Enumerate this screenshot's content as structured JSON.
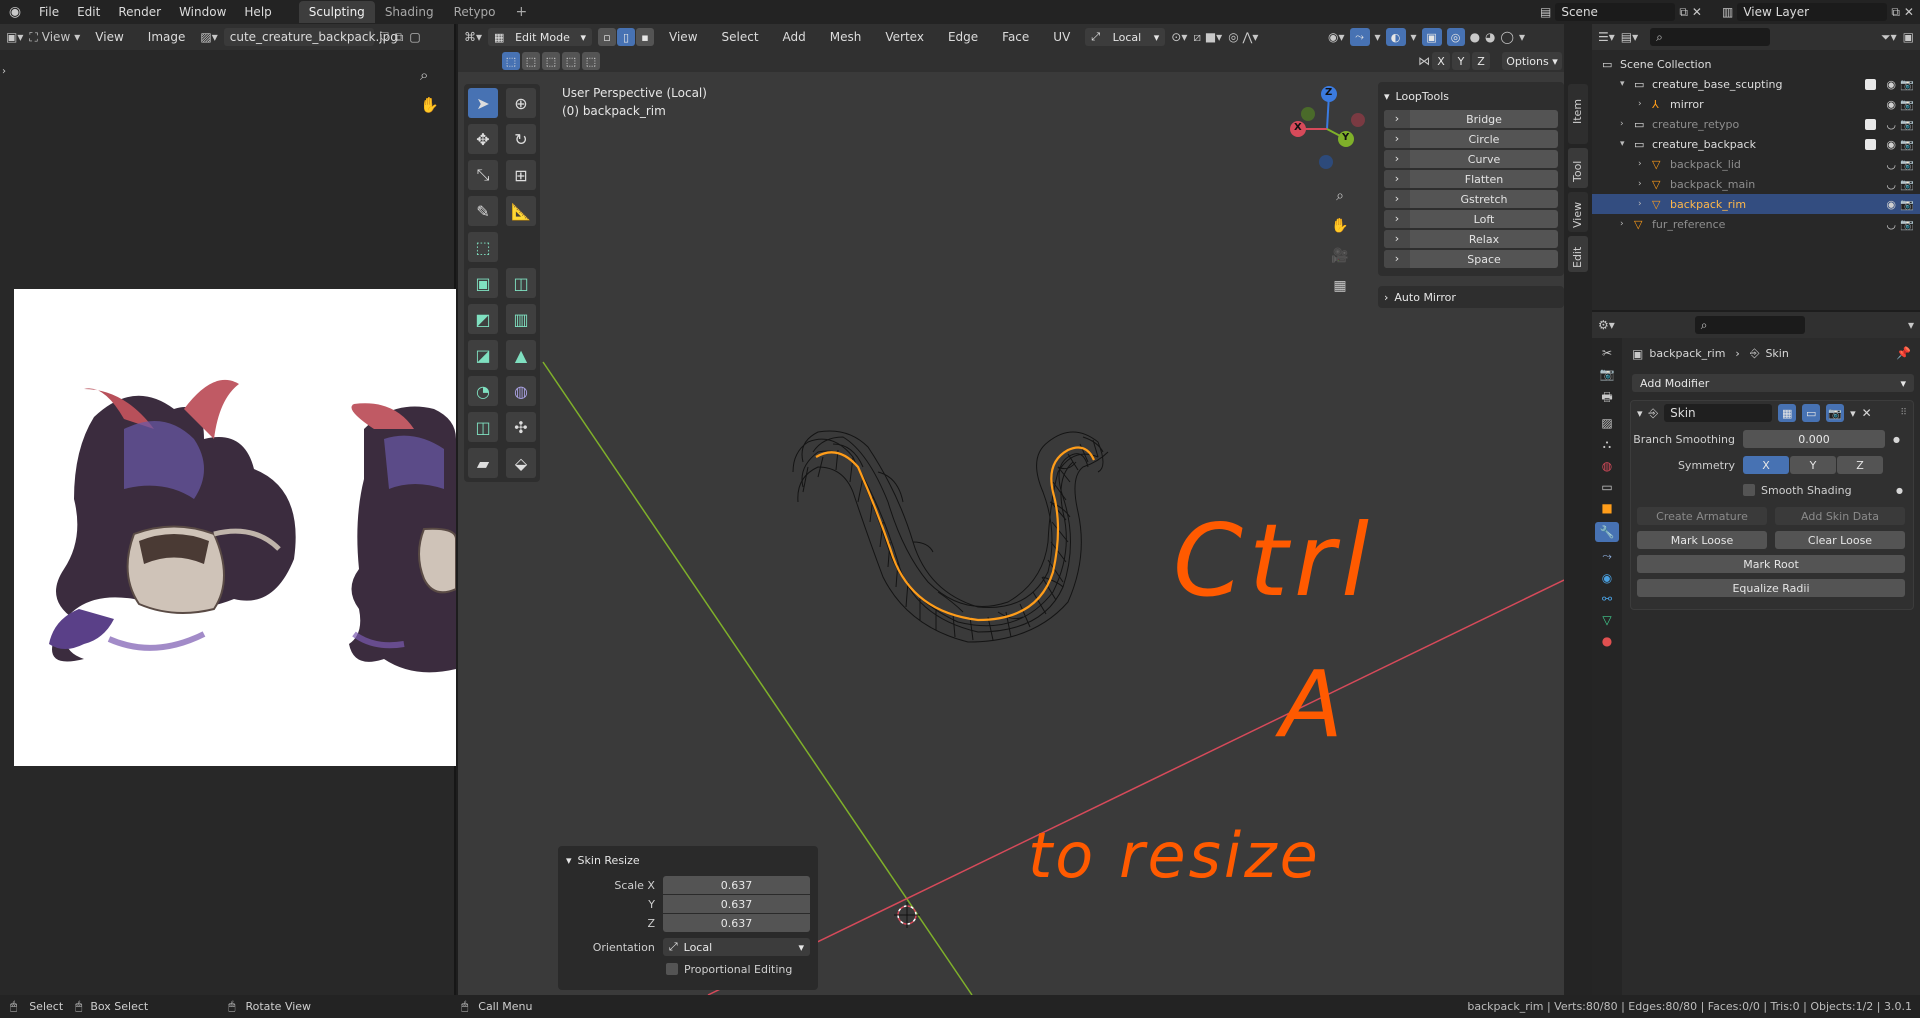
{
  "topbar": {
    "menus": [
      "File",
      "Edit",
      "Render",
      "Window",
      "Help"
    ],
    "workspaces": [
      {
        "label": "Sculpting",
        "active": true
      },
      {
        "label": "Shading",
        "active": false
      },
      {
        "label": "Retypo",
        "active": false
      }
    ],
    "add_workspace": "+",
    "scene": "Scene",
    "view_layer": "View Layer"
  },
  "image_editor": {
    "view_menu": "View",
    "menus": [
      "View",
      "Image"
    ],
    "image_name": "cute_creature_backpack.jpg"
  },
  "viewport_header": {
    "mode": "Edit Mode",
    "menus": [
      "View",
      "Select",
      "Add",
      "Mesh",
      "Vertex",
      "Edge",
      "Face",
      "UV"
    ],
    "transform_orientation": "Local",
    "axes": [
      "X",
      "Y",
      "Z"
    ],
    "options": "Options"
  },
  "viewport": {
    "perspective_label": "User Perspective (Local)",
    "object_label": "(0) backpack_rim",
    "gizmo": {
      "x": "X",
      "y": "Y",
      "z": "Z"
    },
    "annotations": [
      "Ctrl",
      "A",
      "to resize"
    ]
  },
  "loop_tools": {
    "title": "LoopTools",
    "items": [
      "Bridge",
      "Circle",
      "Curve",
      "Flatten",
      "Gstretch",
      "Loft",
      "Relax",
      "Space"
    ],
    "auto_mirror": "Auto Mirror"
  },
  "npanel_tabs": [
    "Item",
    "Tool",
    "View",
    "Edit"
  ],
  "skin_resize": {
    "title": "Skin Resize",
    "scale_label": "Scale X",
    "y_label": "Y",
    "z_label": "Z",
    "x": "0.637",
    "y": "0.637",
    "z": "0.637",
    "orientation_label": "Orientation",
    "orientation": "Local",
    "proportional": "Proportional Editing"
  },
  "outliner": {
    "rows": [
      {
        "label": "Scene Collection",
        "indent": 0,
        "type": "collection"
      },
      {
        "label": "creature_base_scupting",
        "indent": 1,
        "type": "collection",
        "check": true
      },
      {
        "label": "mirror",
        "indent": 2,
        "type": "armature"
      },
      {
        "label": "creature_retypo",
        "indent": 1,
        "type": "collection",
        "dim": true,
        "check": true
      },
      {
        "label": "creature_backpack",
        "indent": 1,
        "type": "collection",
        "check": true
      },
      {
        "label": "backpack_lid",
        "indent": 2,
        "type": "mesh",
        "dim": true
      },
      {
        "label": "backpack_main",
        "indent": 2,
        "type": "mesh",
        "dim": true
      },
      {
        "label": "backpack_rim",
        "indent": 2,
        "type": "mesh",
        "selected": true
      },
      {
        "label": "fur_reference",
        "indent": 1,
        "type": "mesh",
        "dim": true
      }
    ]
  },
  "properties": {
    "breadcrumb_object": "backpack_rim",
    "breadcrumb_modifier": "Skin",
    "add_modifier": "Add Modifier",
    "modifier_name": "Skin",
    "branch_smoothing_label": "Branch Smoothing",
    "branch_smoothing": "0.000",
    "symmetry_label": "Symmetry",
    "symmetry": [
      "X",
      "Y",
      "Z"
    ],
    "smooth_shading": "Smooth Shading",
    "create_armature": "Create Armature",
    "add_skin_data": "Add Skin Data",
    "mark_loose": "Mark Loose",
    "clear_loose": "Clear Loose",
    "mark_root": "Mark Root",
    "equalize_radii": "Equalize Radii"
  },
  "statusbar": {
    "select": "Select",
    "box_select": "Box Select",
    "rotate_view": "Rotate View",
    "call_menu": "Call Menu",
    "stats": "backpack_rim | Verts:80/80 | Edges:80/80 | Faces:0/0 | Tris:0 | Objects:1/2 | 3.0.1"
  },
  "colors": {
    "accent": "#4772b3",
    "annotation": "#ff5a00",
    "selected_edge": "#ff9d1a",
    "x_axis": "#d64a5a",
    "y_axis": "#7fb02a"
  }
}
